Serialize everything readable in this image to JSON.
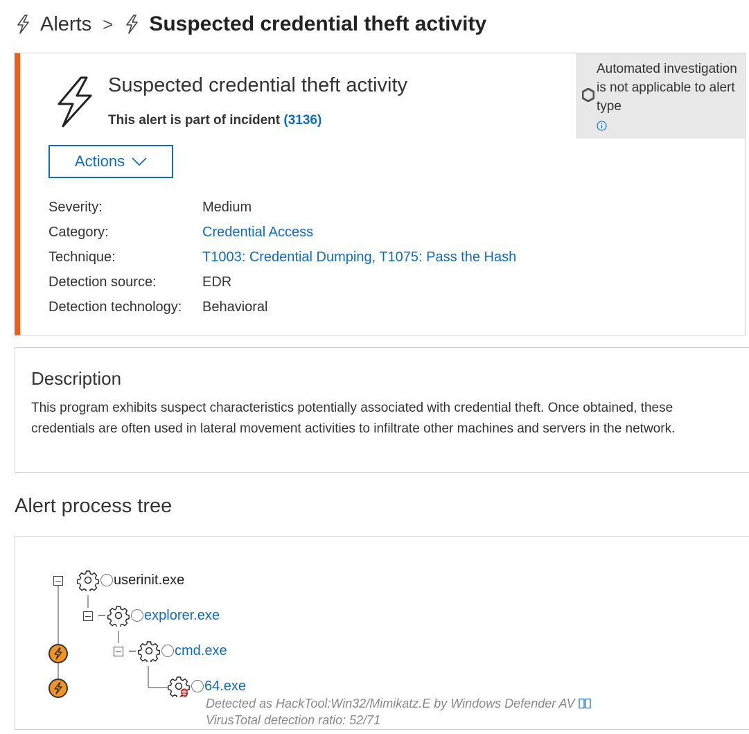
{
  "breadcrumb": {
    "root_label": "Alerts",
    "separator": ">",
    "current_label": "Suspected credential theft activity"
  },
  "alert": {
    "title": "Suspected credential theft activity",
    "incident_text": "This alert is part of incident",
    "incident_number": "(3136)",
    "actions_label": "Actions",
    "severity_color": "#e8601a",
    "automated_investigation": "Automated investigation is not applicable to alert type",
    "properties": [
      {
        "label": "Severity:",
        "value": "Medium",
        "link": false
      },
      {
        "label": "Category:",
        "value": "Credential Access",
        "link": true
      },
      {
        "label": "Technique:",
        "value": "T1003: Credential Dumping, T1075: Pass the Hash",
        "link": true
      },
      {
        "label": "Detection source:",
        "value": "EDR",
        "link": false
      },
      {
        "label": "Detection technology:",
        "value": "Behavioral",
        "link": false
      }
    ]
  },
  "description": {
    "heading": "Description",
    "text": "This program exhibits suspect characteristics potentially associated with credential theft. Once obtained, these credentials are often used in lateral movement activities to infiltrate other machines and servers in the network."
  },
  "process_tree": {
    "heading": "Alert process tree",
    "nodes": [
      {
        "name": "userinit.exe",
        "link": false,
        "icon": "gear-icon"
      },
      {
        "name": "explorer.exe",
        "link": true,
        "icon": "gear-icon"
      },
      {
        "name": "cmd.exe",
        "link": true,
        "icon": "gear-icon"
      },
      {
        "name": "64.exe",
        "link": true,
        "icon": "gear-bug-icon"
      }
    ],
    "detection_text": "Detected as HackTool:Win32/Mimikatz.E by Windows Defender AV",
    "virustotal_text": "VirusTotal detection ratio: 52/71",
    "alert_bubble_color": "#f29424"
  },
  "colors": {
    "link": "#0f6cbd",
    "accent": "#e8601a"
  }
}
